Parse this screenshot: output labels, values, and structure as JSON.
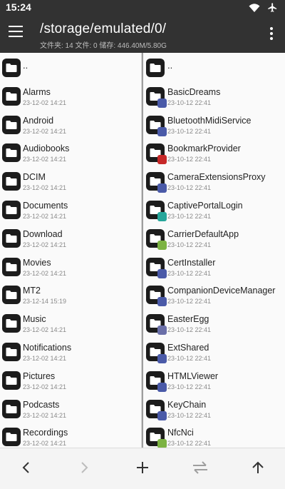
{
  "status": {
    "time": "15:24",
    "icons": [
      "wifi-icon",
      "airplane-icon"
    ]
  },
  "appbar": {
    "path": "/storage/emulated/0/",
    "summary": "文件夹: 14  文件: 0  储存: 446.40M/5.80G"
  },
  "left_pane": {
    "items": [
      {
        "name": "..",
        "date": ""
      },
      {
        "name": "Alarms",
        "date": "23-12-02 14:21"
      },
      {
        "name": "Android",
        "date": "23-12-02 14:21"
      },
      {
        "name": "Audiobooks",
        "date": "23-12-02 14:21"
      },
      {
        "name": "DCIM",
        "date": "23-12-02 14:21"
      },
      {
        "name": "Documents",
        "date": "23-12-02 14:21"
      },
      {
        "name": "Download",
        "date": "23-12-02 14:21"
      },
      {
        "name": "Movies",
        "date": "23-12-02 14:21"
      },
      {
        "name": "MT2",
        "date": "23-12-14 15:19"
      },
      {
        "name": "Music",
        "date": "23-12-02 14:21"
      },
      {
        "name": "Notifications",
        "date": "23-12-02 14:21"
      },
      {
        "name": "Pictures",
        "date": "23-12-02 14:21"
      },
      {
        "name": "Podcasts",
        "date": "23-12-02 14:21"
      },
      {
        "name": "Recordings",
        "date": "23-12-02 14:21"
      }
    ]
  },
  "right_pane": {
    "items": [
      {
        "name": "..",
        "date": "",
        "badge": ""
      },
      {
        "name": "BasicDreams",
        "date": "23-10-12 22:41",
        "badge": "#4a5aa8"
      },
      {
        "name": "BluetoothMidiService",
        "date": "23-10-12 22:41",
        "badge": "#4a5aa8"
      },
      {
        "name": "BookmarkProvider",
        "date": "23-10-12 22:41",
        "badge": "#c62828"
      },
      {
        "name": "CameraExtensionsProxy",
        "date": "23-10-12 22:41",
        "badge": "#4a5aa8"
      },
      {
        "name": "CaptivePortalLogin",
        "date": "23-10-12 22:41",
        "badge": "#26a69a"
      },
      {
        "name": "CarrierDefaultApp",
        "date": "23-10-12 22:41",
        "badge": "#7cb342"
      },
      {
        "name": "CertInstaller",
        "date": "23-10-12 22:41",
        "badge": "#4a5aa8"
      },
      {
        "name": "CompanionDeviceManager",
        "date": "23-10-12 22:41",
        "badge": "#4a5aa8"
      },
      {
        "name": "EasterEgg",
        "date": "23-10-12 22:41",
        "badge": "#6a6fa8"
      },
      {
        "name": "ExtShared",
        "date": "23-10-12 22:41",
        "badge": "#4a5aa8"
      },
      {
        "name": "HTMLViewer",
        "date": "23-10-12 22:41",
        "badge": "#4a5aa8"
      },
      {
        "name": "KeyChain",
        "date": "23-10-12 22:41",
        "badge": "#4a5aa8"
      },
      {
        "name": "NfcNci",
        "date": "23-10-12 22:41",
        "badge": "#7cb342"
      }
    ]
  },
  "bottom_bar": {
    "buttons": [
      "back-icon",
      "forward-icon",
      "add-icon",
      "swap-icon",
      "up-icon"
    ]
  }
}
